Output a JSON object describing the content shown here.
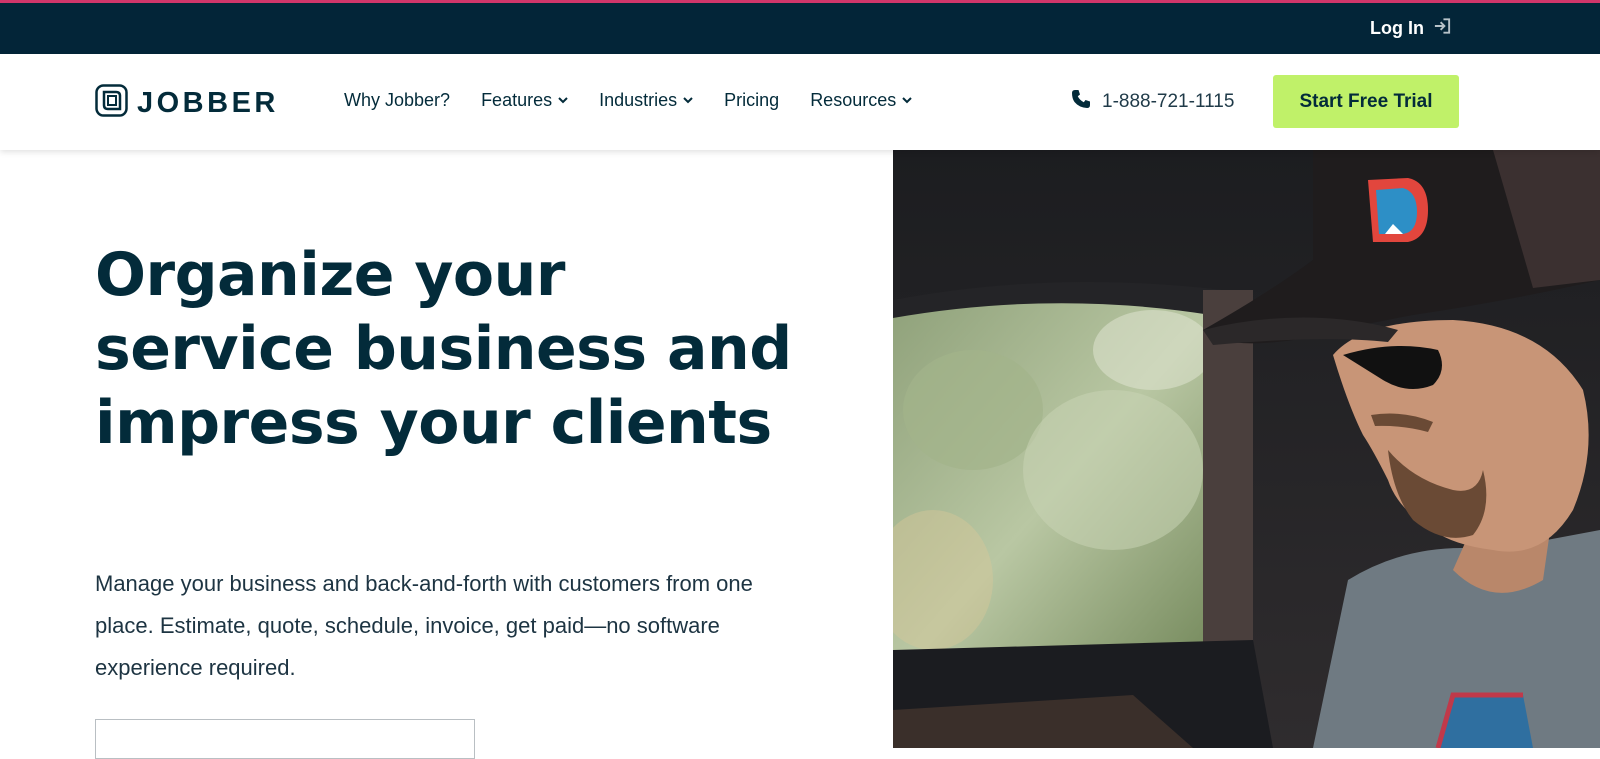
{
  "topbar": {
    "login_label": "Log In",
    "login_icon": "sign-in-icon",
    "accent_color": "#d0366a",
    "background": "#032538"
  },
  "header": {
    "logo_text": "JOBBER",
    "logo_icon": "jobber-mark-icon",
    "nav": [
      {
        "label": "Why Jobber?",
        "has_dropdown": false
      },
      {
        "label": "Features",
        "has_dropdown": true
      },
      {
        "label": "Industries",
        "has_dropdown": true
      },
      {
        "label": "Pricing",
        "has_dropdown": false
      },
      {
        "label": "Resources",
        "has_dropdown": true
      }
    ],
    "phone": "1-888-721-1115",
    "phone_icon": "phone-icon",
    "cta_label": "Start Free Trial",
    "cta_color": "#c0f169"
  },
  "hero": {
    "title": "Organize your service business and impress your clients",
    "subtitle": "Manage your business and back-and-forth with customers from one place. Estimate, quote, schedule, invoice, get paid—no software experience required.",
    "title_color": "#032b3a"
  }
}
